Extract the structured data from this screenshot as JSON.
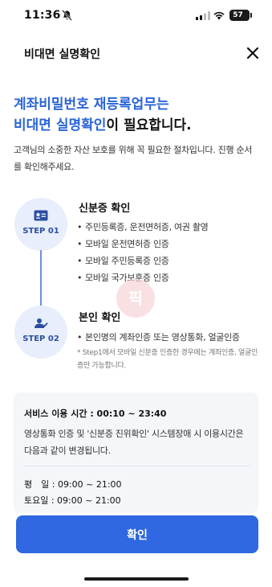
{
  "status_bar": {
    "time": "11:36",
    "battery": "57"
  },
  "header": {
    "title": "비대면 실명확인"
  },
  "headline": {
    "line1": "계좌비밀번호 재등록업무는",
    "line2_blue": "비대면 실명확인",
    "line2_rest": "이 필요합니다."
  },
  "intro": "고객님의 소중한 자산 보호를 위해 꼭 필요한 절차입니다. 진행 순서를 확인해주세요.",
  "steps": [
    {
      "label": "STEP 01",
      "title": "신분증 확인",
      "icon": "id-card-icon",
      "items": [
        "주민등록증, 운전면허증, 여권 촬영",
        "모바일 운전면허증 인증",
        "모바일 주민등록증 인증",
        "모바일 국가보훈증 인증"
      ]
    },
    {
      "label": "STEP 02",
      "title": "본인 확인",
      "icon": "user-check-icon",
      "items": [
        "본인명의 계좌인증 또는 영상통화, 얼굴인증"
      ],
      "note": "* Step1에서 모바일 신분증 인증한 경우에는 계좌인증, 얼굴인증만 가능합니다."
    }
  ],
  "watermark": {
    "text": "픽"
  },
  "service": {
    "title": "서비스 이용 시간 : 00:10 ~ 23:40",
    "desc": "영상통화 인증 및 '신분증 진위확인' 시스템장애 시 이용시간은 다음과 같이 변경됩니다.",
    "weekday": "평　일 : 09:00 ~ 21:00",
    "saturday": "토요일 : 09:00 ~ 21:00"
  },
  "confirm_label": "확인",
  "colors": {
    "accent": "#2f68e0",
    "headline_blue": "#2a64d8",
    "step_bg": "#e8eefb"
  }
}
